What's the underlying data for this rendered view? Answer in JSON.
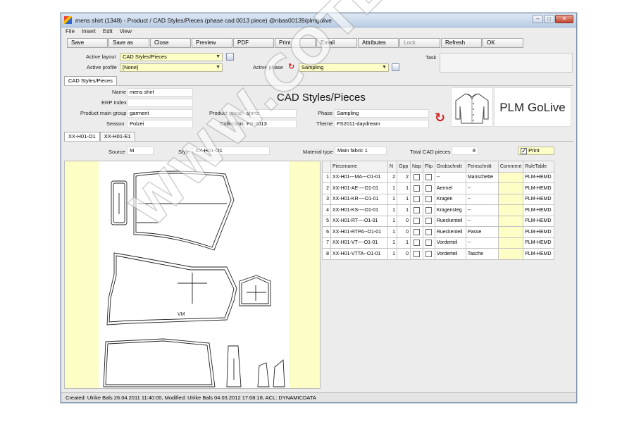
{
  "window": {
    "title": "mens shirt (1348) - Product / CAD Styles/Pieces (phase cad 0013 piece) @nbas00139/plmgolive",
    "buttons": [
      "–",
      "□",
      "✕"
    ]
  },
  "menu": [
    "File",
    "Insert",
    "Edit",
    "View"
  ],
  "toolbar": [
    {
      "label": "Save",
      "enabled": true
    },
    {
      "label": "Save as",
      "enabled": true
    },
    {
      "label": "Close",
      "enabled": true
    },
    {
      "label": "Preview",
      "enabled": true
    },
    {
      "label": "PDF",
      "enabled": true
    },
    {
      "label": "Print",
      "enabled": true
    },
    {
      "label": "Email",
      "enabled": true
    },
    {
      "label": "Attributes",
      "enabled": true
    },
    {
      "label": "Lock",
      "enabled": false
    },
    {
      "label": "Refresh",
      "enabled": true
    },
    {
      "label": "OK",
      "enabled": true
    }
  ],
  "layout_bar": {
    "active_layout_label": "Active layout",
    "active_layout_value": "CAD Styles/Pieces",
    "active_profile_label": "Active profile",
    "active_profile_value": "[None]",
    "active_phase_label": "Active phase",
    "active_phase_value": "Sampling",
    "task_label": "Task"
  },
  "main_tab": "CAD Styles/Pieces",
  "header": {
    "title": "CAD Styles/Pieces",
    "name_label": "Name",
    "name_value": "mens shirt",
    "erp_label": "ERP Index",
    "erp_value": "",
    "main_group_label": "Product main group",
    "main_group_value": "garment",
    "season_label": "Season",
    "season_value": "Polzei",
    "group_label": "Product group",
    "group_value": "shirts",
    "collection_label": "Collection",
    "collection_value": "FS-2013",
    "phase_label": "Phase",
    "phase_value": "Sampling",
    "theme_label": "Theme",
    "theme_value": "FS2011-daydream",
    "brand": "PLM GoLive"
  },
  "sub_tabs": [
    "XX-H01-O1",
    "XX-H01-E1"
  ],
  "details": {
    "source_label": "Source",
    "source_value": "M",
    "style_label": "Style",
    "style_value": "XX-H01-O1",
    "material_label": "Material type",
    "material_value": "Main fabric 1",
    "total_label": "Total CAD pieces",
    "total_value": "8",
    "print_label": "Print",
    "print_checked": true
  },
  "grid": {
    "columns": [
      "",
      "Piecename",
      "N",
      "Opp",
      "Nap",
      "Flip",
      "Grobschnitt",
      "Feinschnitt",
      "Comment",
      "RuleTable"
    ],
    "rows": [
      [
        "1",
        "XX-H01---MA---O1-01",
        "2",
        "2",
        "",
        "",
        "--",
        "Manschette",
        "",
        "PLM-HEMD"
      ],
      [
        "2",
        "XX-H01-AE----O1-01",
        "1",
        "1",
        "",
        "",
        "Aermel",
        "--",
        "",
        "PLM-HEMD"
      ],
      [
        "3",
        "XX-H01-KR----O1-01",
        "1",
        "1",
        "",
        "",
        "Kragen",
        "--",
        "",
        "PLM-HEMD"
      ],
      [
        "4",
        "XX-H01-KS----O1-01",
        "1",
        "1",
        "",
        "",
        "Kragensteg",
        "--",
        "",
        "PLM-HEMD"
      ],
      [
        "5",
        "XX-H01-RT----O1-01",
        "1",
        "0",
        "",
        "",
        "Rueckenteil",
        "--",
        "",
        "PLM-HEMD"
      ],
      [
        "6",
        "XX-H01-RTPA--O1-01",
        "1",
        "0",
        "",
        "",
        "Rueckenteil",
        "Passe",
        "",
        "PLM-HEMD"
      ],
      [
        "7",
        "XX-H01-VT----O1-01",
        "1",
        "1",
        "",
        "",
        "Vorderteil",
        "--",
        "",
        "PLM-HEMD"
      ],
      [
        "8",
        "XX-H01-VTTA--O1-01",
        "1",
        "0",
        "",
        "",
        "Vorderteil",
        "Tasche",
        "",
        "PLM-HEMD"
      ]
    ]
  },
  "canvas": {
    "piece_label": "VM"
  },
  "status": "Created: Ulrike Bals 26.04.2011 11:40:00, Modified: Ulrike Bals 04.03.2012 17:08:18, ACL: DYNAMICDATA",
  "watermark": "WWW.COTEC.PL",
  "colors": {
    "yellow_field": "#fdfdc6",
    "refresh_red": "#d21f1f",
    "title_gradient": "#b9cce3"
  }
}
